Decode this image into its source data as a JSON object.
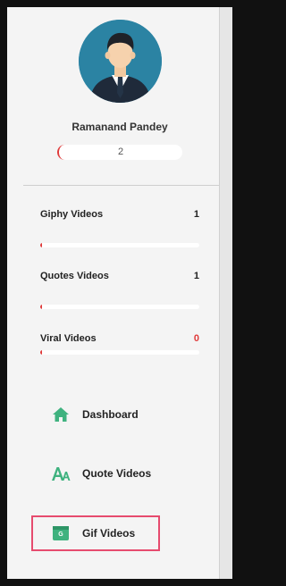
{
  "profile": {
    "name": "Ramanand Pandey",
    "count": "2"
  },
  "stats": [
    {
      "label": "Giphy Videos",
      "value": "1",
      "progress": 0.01
    },
    {
      "label": "Quotes Videos",
      "value": "1",
      "progress": 0.01
    },
    {
      "label": "Viral Videos",
      "value": "0",
      "progress": 0.01
    }
  ],
  "nav": [
    {
      "label": "Dashboard",
      "icon": "home-icon",
      "active": false
    },
    {
      "label": "Quote Videos",
      "icon": "quote-letters-icon",
      "active": false
    },
    {
      "label": "Gif Videos",
      "icon": "gif-icon",
      "icon_text": "G",
      "active": true
    }
  ],
  "colors": {
    "accent_green": "#3fb27f",
    "alert_red": "#e03a3a",
    "active_border": "#e64b6e",
    "avatar_bg": "#2b83a3"
  }
}
